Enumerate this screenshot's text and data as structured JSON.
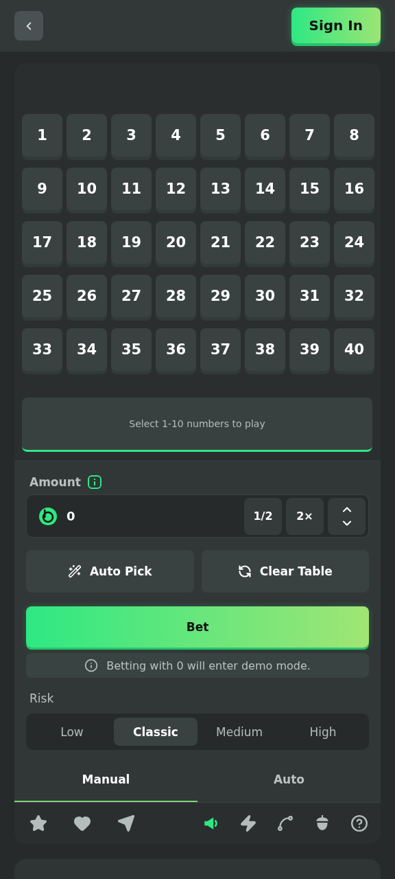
{
  "header": {
    "sign_in": "Sign In"
  },
  "numbers": [
    {
      "label": "1",
      "selected": false
    },
    {
      "label": "2",
      "selected": false
    },
    {
      "label": "3",
      "selected": false
    },
    {
      "label": "4",
      "selected": false
    },
    {
      "label": "5",
      "selected": false
    },
    {
      "label": "6",
      "selected": false
    },
    {
      "label": "7",
      "selected": false
    },
    {
      "label": "8",
      "selected": false
    },
    {
      "label": "9",
      "selected": false
    },
    {
      "label": "10",
      "selected": false
    },
    {
      "label": "11",
      "selected": false
    },
    {
      "label": "12",
      "selected": false
    },
    {
      "label": "13",
      "selected": false
    },
    {
      "label": "14",
      "selected": false
    },
    {
      "label": "15",
      "selected": false
    },
    {
      "label": "16",
      "selected": false
    },
    {
      "label": "17",
      "selected": false
    },
    {
      "label": "18",
      "selected": false
    },
    {
      "label": "19",
      "selected": false
    },
    {
      "label": "20",
      "selected": false
    },
    {
      "label": "21",
      "selected": false
    },
    {
      "label": "22",
      "selected": false
    },
    {
      "label": "23",
      "selected": false
    },
    {
      "label": "24",
      "selected": false
    },
    {
      "label": "25",
      "selected": false
    },
    {
      "label": "26",
      "selected": false
    },
    {
      "label": "27",
      "selected": false
    },
    {
      "label": "28",
      "selected": false
    },
    {
      "label": "29",
      "selected": false
    },
    {
      "label": "30",
      "selected": false
    },
    {
      "label": "31",
      "selected": false
    },
    {
      "label": "32",
      "selected": false
    },
    {
      "label": "33",
      "selected": false
    },
    {
      "label": "34",
      "selected": false
    },
    {
      "label": "35",
      "selected": false
    },
    {
      "label": "36",
      "selected": false
    },
    {
      "label": "37",
      "selected": false
    },
    {
      "label": "38",
      "selected": false
    },
    {
      "label": "39",
      "selected": false
    },
    {
      "label": "40",
      "selected": false
    }
  ],
  "message": "Select 1-10 numbers to play",
  "amount": {
    "label": "Amount",
    "value": "0",
    "half": "1/2",
    "double": "2×"
  },
  "actions": [
    "Auto Pick",
    "Clear Table"
  ],
  "bet_button": "Bet",
  "notice": "Betting with 0 will enter demo mode.",
  "risk": {
    "label": "Risk",
    "options": [
      {
        "label": "Low",
        "selected": false
      },
      {
        "label": "Classic",
        "selected": true
      },
      {
        "label": "Medium",
        "selected": false
      },
      {
        "label": "High",
        "selected": false
      }
    ]
  },
  "mode_tabs": [
    {
      "label": "Manual",
      "selected": true
    },
    {
      "label": "Auto",
      "selected": false
    }
  ],
  "footer_left": [
    {
      "kind": "star",
      "active": false
    },
    {
      "kind": "heart",
      "active": false
    },
    {
      "kind": "send",
      "active": false
    }
  ],
  "footer_right": [
    {
      "kind": "sound",
      "active": true
    },
    {
      "kind": "bolt",
      "active": false
    },
    {
      "kind": "route",
      "active": false
    },
    {
      "kind": "acorn",
      "active": false
    },
    {
      "kind": "help",
      "active": false
    }
  ]
}
